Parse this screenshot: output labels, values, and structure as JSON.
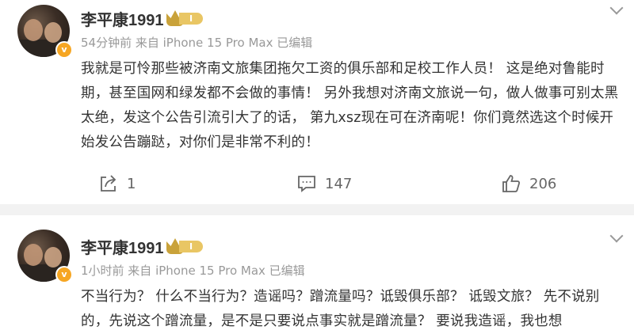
{
  "posts": [
    {
      "username": "李平康1991",
      "level": "I",
      "verified_mark": "v",
      "meta": "54分钟前 来自 iPhone 15 Pro Max 已编辑",
      "content": "我就是可怜那些被济南文旅集团拖欠工资的俱乐部和足校工作人员！ 这是绝对鲁能时期，甚至国网和绿发都不会做的事情！ 另外我想对济南文旅说一句，做人做事可别太黑太绝，发这个公告引流引大了的话， 第九xsz现在可在济南呢！你们竟然选这个时候开始发公告蹦跶，对你们是非常不利的！",
      "shares": "1",
      "comments": "147",
      "likes": "206"
    },
    {
      "username": "李平康1991",
      "level": "I",
      "verified_mark": "v",
      "meta": "1小时前 来自 iPhone 15 Pro Max 已编辑",
      "content": "不当行为？ 什么不当行为？造谣吗？蹭流量吗？诋毁俱乐部？ 诋毁文旅？ 先不说别的，先说这个蹭流量，是不是只要说点事实就是蹭流量？ 要说我造谣，我也想"
    }
  ],
  "icons": {
    "share": "share-icon",
    "comment": "comment-icon",
    "like": "thumbs-up-icon",
    "more": "chevron-down-icon",
    "verified": "verified-badge-icon",
    "crown": "crown-level-icon"
  },
  "colors": {
    "accent_badge": "#f6a623",
    "level_gold": "#e9c664",
    "meta_text": "#999999",
    "separator": "#f2f2f2"
  }
}
